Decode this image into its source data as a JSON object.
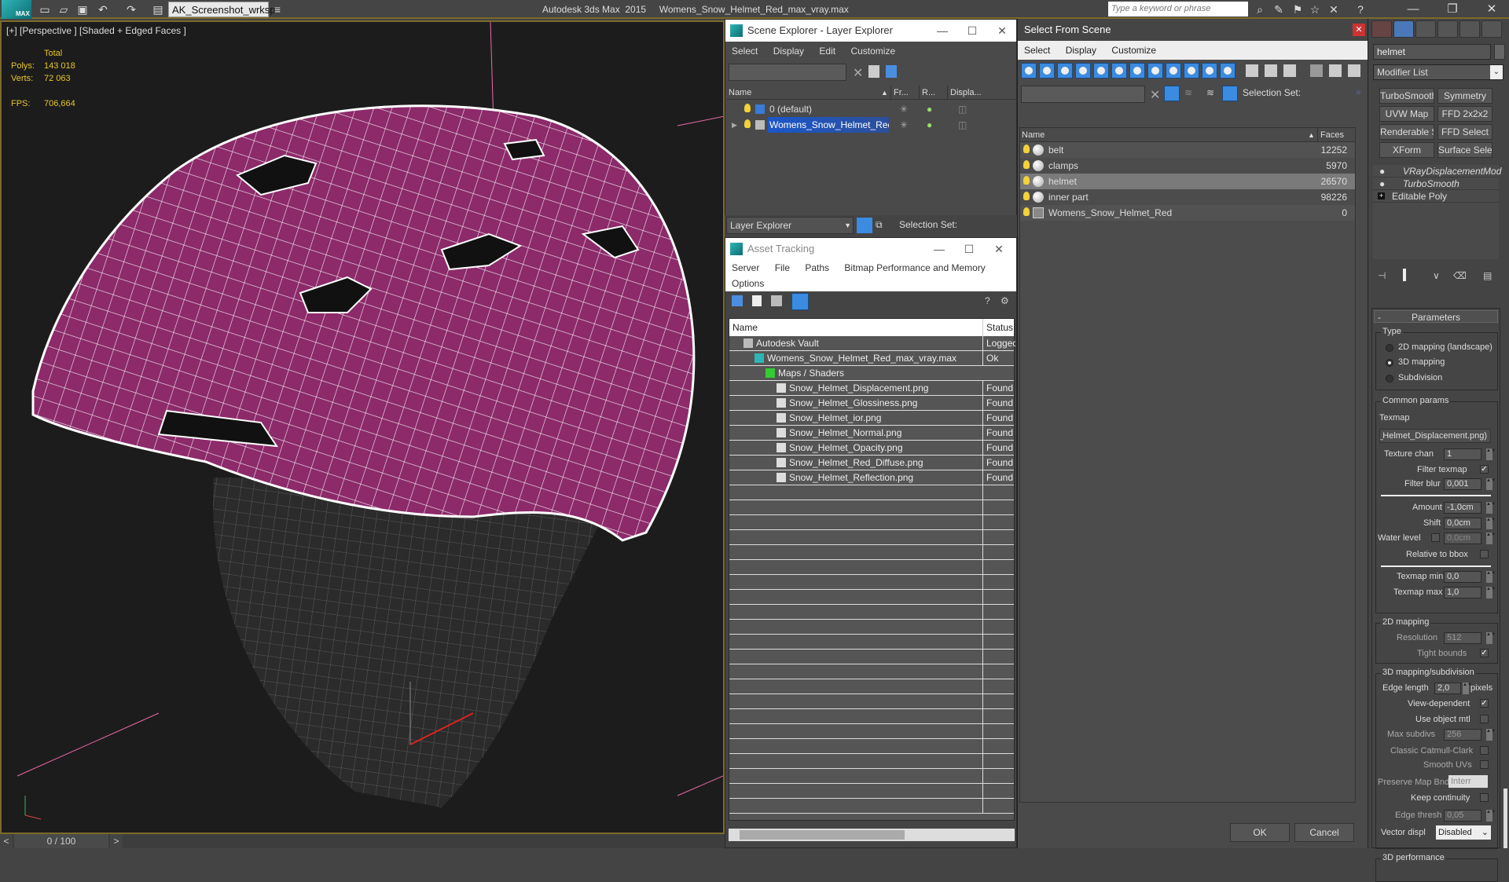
{
  "titlebar": {
    "app_name": "Autodesk 3ds Max  2015",
    "file_name": "Womens_Snow_Helmet_Red_max_vray.max",
    "logo_label": "MAX",
    "workspace": "AK_Screenshot_wrksp",
    "search_placeholder": "Type a keyword or phrase"
  },
  "viewport": {
    "label": "[+] [Perspective ] [Shaded + Edged Faces ]",
    "stats_header": "Total",
    "polys_label": "Polys:",
    "polys_value": "143 018",
    "verts_label": "Verts:",
    "verts_value": "72 063",
    "fps_label": "FPS:",
    "fps_value": "706,664",
    "helmet_color": "#8c2a6a"
  },
  "timeline": {
    "counter": "0 / 100",
    "prev": "<",
    "next": ">"
  },
  "scene_explorer": {
    "title": "Scene Explorer - Layer Explorer",
    "menu": [
      "Select",
      "Display",
      "Edit",
      "Customize"
    ],
    "columns": [
      "Name",
      "Fr...",
      "R...",
      "Displa..."
    ],
    "rows": [
      {
        "name": "0 (default)",
        "selected": false
      },
      {
        "name": "Womens_Snow_Helmet_Red",
        "selected": true
      }
    ],
    "footer_dropdown": "Layer Explorer",
    "selection_set_label": "Selection Set:"
  },
  "asset_tracking": {
    "title": "Asset Tracking",
    "menu": [
      "Server",
      "File",
      "Paths",
      "Bitmap Performance and Memory",
      "Options"
    ],
    "columns": [
      "Name",
      "Status"
    ],
    "rows": [
      {
        "name": "Autodesk Vault",
        "status": "Logged",
        "indent": 0,
        "icon": "vault-icon"
      },
      {
        "name": "Womens_Snow_Helmet_Red_max_vray.max",
        "status": "Ok",
        "indent": 1,
        "icon": "max-file-icon"
      },
      {
        "name": "Maps / Shaders",
        "status": "",
        "indent": 2,
        "icon": "maps-icon"
      },
      {
        "name": "Snow_Helmet_Displacement.png",
        "status": "Found",
        "indent": 3,
        "icon": "image-file-icon"
      },
      {
        "name": "Snow_Helmet_Glossiness.png",
        "status": "Found",
        "indent": 3,
        "icon": "image-file-icon"
      },
      {
        "name": "Snow_Helmet_ior.png",
        "status": "Found",
        "indent": 3,
        "icon": "image-file-icon"
      },
      {
        "name": "Snow_Helmet_Normal.png",
        "status": "Found",
        "indent": 3,
        "icon": "image-file-icon"
      },
      {
        "name": "Snow_Helmet_Opacity.png",
        "status": "Found",
        "indent": 3,
        "icon": "image-file-icon"
      },
      {
        "name": "Snow_Helmet_Red_Diffuse.png",
        "status": "Found",
        "indent": 3,
        "icon": "image-file-icon"
      },
      {
        "name": "Snow_Helmet_Reflection.png",
        "status": "Found",
        "indent": 3,
        "icon": "image-file-icon"
      }
    ]
  },
  "select_from_scene": {
    "title": "Select From Scene",
    "menu": [
      "Select",
      "Display",
      "Customize"
    ],
    "selection_set_label": "Selection Set:",
    "columns": [
      "Name",
      "Faces"
    ],
    "rows": [
      {
        "name": "belt",
        "faces": "12252",
        "selected": false
      },
      {
        "name": "clamps",
        "faces": "5970",
        "selected": false
      },
      {
        "name": "helmet",
        "faces": "26570",
        "selected": true
      },
      {
        "name": "inner part",
        "faces": "98226",
        "selected": false
      },
      {
        "name": "Womens_Snow_Helmet_Red",
        "faces": "0",
        "selected": false,
        "group": true
      }
    ],
    "ok_label": "OK",
    "cancel_label": "Cancel"
  },
  "command_panel": {
    "object_name": "helmet",
    "modifier_list": "Modifier List",
    "modifier_buttons": [
      "TurboSmooth",
      "Symmetry",
      "UVW Map",
      "FFD 2x2x2",
      "Renderable Spline",
      "FFD Select",
      "XForm",
      "Surface Select"
    ],
    "stack": [
      {
        "name": "VRayDisplacementMod",
        "italic": true
      },
      {
        "name": "TurboSmooth",
        "italic": true
      },
      {
        "name": "Editable Poly",
        "italic": false
      }
    ],
    "parameters": {
      "rollout_title": "Parameters",
      "collapse": "-",
      "type_group": "Type",
      "type_options": [
        "2D mapping (landscape)",
        "3D mapping",
        "Subdivision"
      ],
      "type_selected": "3D mapping",
      "common_group": "Common params",
      "texmap_label": "Texmap",
      "texmap_value": "(Snow_Helmet_Displacement.png)",
      "texture_chan_label": "Texture chan",
      "texture_chan": "1",
      "filter_texmap_label": "Filter texmap",
      "filter_texmap": true,
      "filter_blur_label": "Filter blur",
      "filter_blur": "0,001",
      "amount_label": "Amount",
      "amount": "-1,0cm",
      "shift_label": "Shift",
      "shift": "0,0cm",
      "water_level_label": "Water level",
      "water_level": "0,0cm",
      "water_level_enabled": false,
      "relative_bbox_label": "Relative to bbox",
      "relative_bbox": false,
      "texmap_min_label": "Texmap min",
      "texmap_min": "0,0",
      "texmap_max_label": "Texmap max",
      "texmap_max": "1,0",
      "mapping2d_group": "2D mapping",
      "resolution_label": "Resolution",
      "resolution": "512",
      "tight_bounds_label": "Tight bounds",
      "tight_bounds": true,
      "mapping3d_group": "3D mapping/subdivision",
      "edge_length_label": "Edge length",
      "edge_length": "2,0",
      "pixels_label": "pixels",
      "view_dependent_label": "View-dependent",
      "view_dependent": true,
      "use_object_mtl_label": "Use object mtl",
      "use_object_mtl": false,
      "max_subdivs_label": "Max subdivs",
      "max_subdivs": "256",
      "catmull_label": "Classic Catmull-Clark",
      "catmull": false,
      "smooth_uvs_label": "Smooth UVs",
      "smooth_uvs": false,
      "preserve_map_label": "Preserve Map Bnd",
      "preserve_map": "Interr",
      "keep_continuity_label": "Keep continuity",
      "keep_continuity": false,
      "edge_thresh_label": "Edge thresh",
      "edge_thresh": "0,05",
      "vector_displ_label": "Vector displ",
      "vector_displ": "Disabled",
      "performance_group": "3D performance"
    }
  }
}
